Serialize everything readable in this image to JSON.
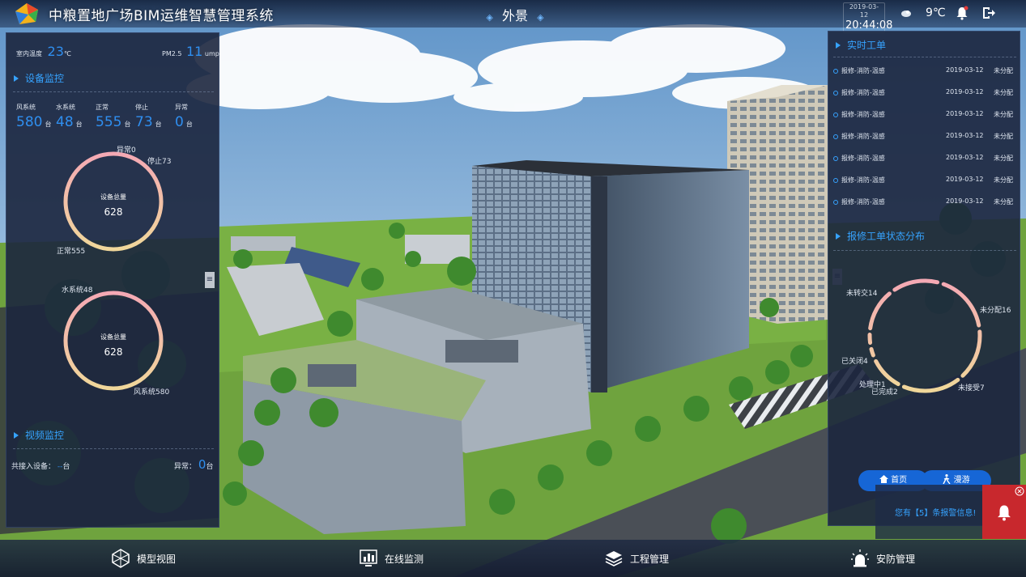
{
  "header": {
    "app_title": "中粮置地广场BIM运维智慧管理系统",
    "scene_title": "外景",
    "date": "2019-03-12",
    "time": "20:44:08",
    "temperature": "9℃"
  },
  "left": {
    "indoor_temp_label": "室内温度",
    "indoor_temp_value": "23",
    "indoor_temp_unit": "℃",
    "pm_label": "PM2.5",
    "pm_value": "11",
    "pm_unit": "ump",
    "device_section": "设备监控",
    "stats": [
      {
        "label": "风系统",
        "value": "580",
        "unit": "台"
      },
      {
        "label": "水系统",
        "value": "48",
        "unit": "台"
      },
      {
        "label": "正常",
        "value": "555",
        "unit": "台"
      },
      {
        "label": "停止",
        "value": "73",
        "unit": "台"
      },
      {
        "label": "异常",
        "value": "0",
        "unit": "台"
      }
    ],
    "ring1": {
      "title": "设备总量",
      "total": "628",
      "labels": {
        "abnormal": "异常0",
        "stopped": "停止73",
        "normal": "正常555"
      },
      "values": {
        "normal": 555,
        "stopped": 73,
        "abnormal": 0
      }
    },
    "ring2": {
      "title": "设备总量",
      "total": "628",
      "labels": {
        "water": "水系统48",
        "wind": "风系统580"
      },
      "values": {
        "wind": 580,
        "water": 48
      }
    },
    "video_section": "视频监控",
    "video_connected_label": "共接入设备：",
    "video_connected_value": "--",
    "video_connected_unit": "台",
    "video_abnormal_label": "异常：",
    "video_abnormal_value": "0",
    "video_abnormal_unit": "台"
  },
  "right": {
    "workorder_section": "实时工单",
    "workorders": [
      {
        "name": "报修-消防-温感",
        "date": "2019-03-12",
        "status": "未分配"
      },
      {
        "name": "报修-消防-温感",
        "date": "2019-03-12",
        "status": "未分配"
      },
      {
        "name": "报修-消防-温感",
        "date": "2019-03-12",
        "status": "未分配"
      },
      {
        "name": "报修-消防-温感",
        "date": "2019-03-12",
        "status": "未分配"
      },
      {
        "name": "报修-消防-温感",
        "date": "2019-03-12",
        "status": "未分配"
      },
      {
        "name": "报修-消防-温感",
        "date": "2019-03-12",
        "status": "未分配"
      },
      {
        "name": "报修-消防-温感",
        "date": "2019-03-12",
        "status": "未分配"
      }
    ],
    "status_section": "报修工单状态分布",
    "status_labels": {
      "not_transferred": "未转交14",
      "unassigned": "未分配16",
      "closed": "已关闭4",
      "processing": "处理中1",
      "completed": "已完成2",
      "not_received": "未接受7"
    }
  },
  "nav_pills": {
    "home": "首页",
    "roam": "漫游"
  },
  "alarm": {
    "text": "您有【5】条报警信息!"
  },
  "bottom_nav": [
    {
      "label": "模型视图",
      "icon": "model-view-icon"
    },
    {
      "label": "在线监测",
      "icon": "online-monitor-icon"
    },
    {
      "label": "工程管理",
      "icon": "engineering-icon"
    },
    {
      "label": "安防管理",
      "icon": "security-icon"
    }
  ],
  "colors": {
    "accent": "#36a3ff",
    "number": "#2f8ff0",
    "alarm": "#c8282d",
    "pill": "#1666d6"
  }
}
